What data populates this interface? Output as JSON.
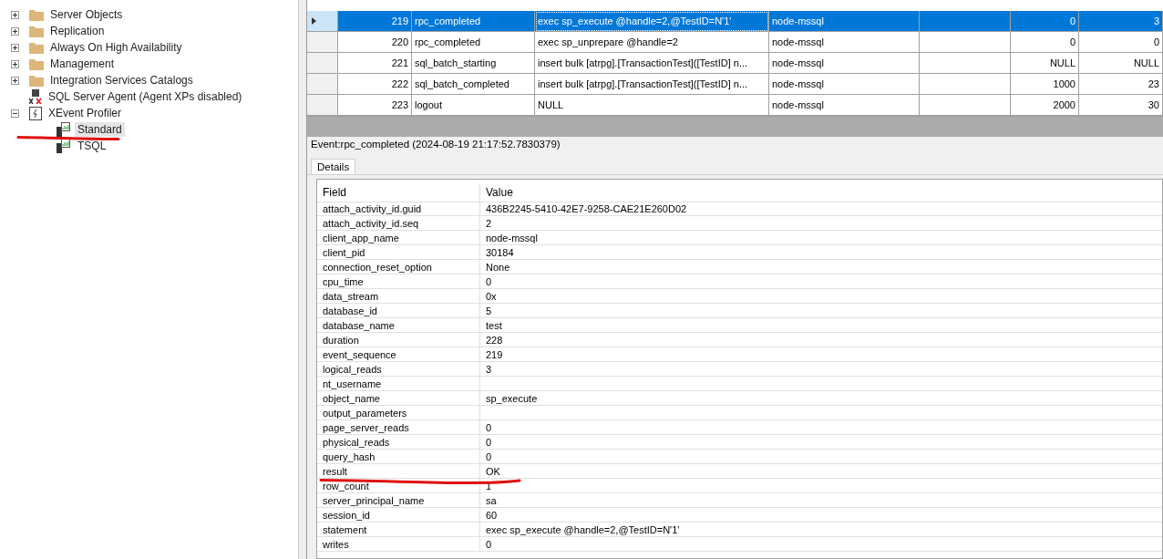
{
  "tree": {
    "items": [
      {
        "label": "Server Objects",
        "expanded": false,
        "kind": "folder",
        "selected": false
      },
      {
        "label": "Replication",
        "expanded": false,
        "kind": "folder",
        "selected": false
      },
      {
        "label": "Always On High Availability",
        "expanded": false,
        "kind": "folder",
        "selected": false
      },
      {
        "label": "Management",
        "expanded": false,
        "kind": "folder",
        "selected": false
      },
      {
        "label": "Integration Services Catalogs",
        "expanded": false,
        "kind": "folder",
        "selected": false
      },
      {
        "label": "SQL Server Agent (Agent XPs disabled)",
        "kind": "agent",
        "selected": false
      },
      {
        "label": "XEvent Profiler",
        "expanded": true,
        "kind": "profiler",
        "selected": false,
        "children": [
          {
            "label": "Standard",
            "kind": "session",
            "selected": true
          },
          {
            "label": "TSQL",
            "kind": "session",
            "selected": false
          }
        ]
      }
    ]
  },
  "events": {
    "rows": [
      {
        "selected": true,
        "cells": [
          "219",
          "rpc_completed",
          "exec sp_execute @handle=2,@TestID=N'1'",
          "node-mssql",
          "",
          "0",
          "3"
        ]
      },
      {
        "selected": false,
        "cells": [
          "220",
          "rpc_completed",
          "exec sp_unprepare @handle=2",
          "node-mssql",
          "",
          "0",
          "0"
        ]
      },
      {
        "selected": false,
        "cells": [
          "221",
          "sql_batch_starting",
          "insert bulk [atrpg].[TransactionTest]([TestID] n...",
          "node-mssql",
          "",
          "NULL",
          "NULL"
        ]
      },
      {
        "selected": false,
        "cells": [
          "222",
          "sql_batch_completed",
          "insert bulk [atrpg].[TransactionTest]([TestID] n...",
          "node-mssql",
          "",
          "1000",
          "23"
        ]
      },
      {
        "selected": false,
        "cells": [
          "223",
          "logout",
          "NULL",
          "node-mssql",
          "",
          "2000",
          "30"
        ]
      }
    ]
  },
  "event_title": "Event:rpc_completed (2024-08-19 21:17:52.7830379)",
  "tabs": [
    {
      "label": "Details",
      "selected": true
    }
  ],
  "details": {
    "columns": [
      "Field",
      "Value"
    ],
    "rows": [
      [
        "attach_activity_id.guid",
        "436B2245-5410-42E7-9258-CAE21E260D02"
      ],
      [
        "attach_activity_id.seq",
        "2"
      ],
      [
        "client_app_name",
        "node-mssql"
      ],
      [
        "client_pid",
        "30184"
      ],
      [
        "connection_reset_option",
        "None"
      ],
      [
        "cpu_time",
        "0"
      ],
      [
        "data_stream",
        "0x"
      ],
      [
        "database_id",
        "5"
      ],
      [
        "database_name",
        "test"
      ],
      [
        "duration",
        "228"
      ],
      [
        "event_sequence",
        "219"
      ],
      [
        "logical_reads",
        "3"
      ],
      [
        "nt_username",
        ""
      ],
      [
        "object_name",
        "sp_execute"
      ],
      [
        "output_parameters",
        ""
      ],
      [
        "page_server_reads",
        "0"
      ],
      [
        "physical_reads",
        "0"
      ],
      [
        "query_hash",
        "0"
      ],
      [
        "result",
        "OK"
      ],
      [
        "row_count",
        "1"
      ],
      [
        "server_principal_name",
        "sa"
      ],
      [
        "session_id",
        "60"
      ],
      [
        "statement",
        "exec sp_execute @handle=2,@TestID=N'1'"
      ],
      [
        "writes",
        "0"
      ]
    ]
  }
}
